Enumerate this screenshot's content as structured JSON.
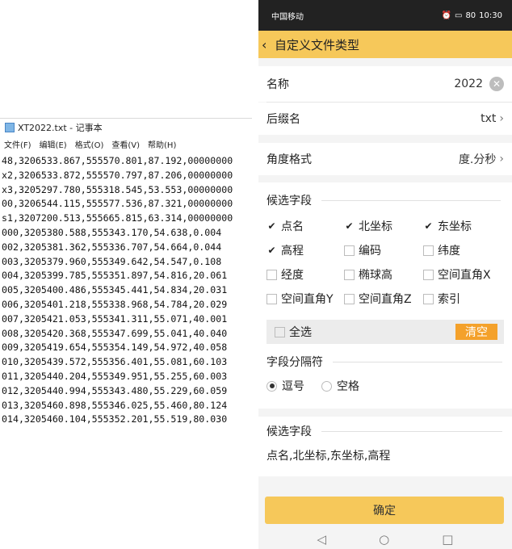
{
  "notepad": {
    "title": "XT2022.txt - 记事本",
    "menu": [
      "文件(F)",
      "编辑(E)",
      "格式(O)",
      "查看(V)",
      "帮助(H)"
    ],
    "lines": [
      "48,3206533.867,555570.801,87.192,00000000",
      "x2,3206533.872,555570.797,87.206,00000000",
      "x3,3205297.780,555318.545,53.553,00000000",
      "00,3206544.115,555577.536,87.321,00000000",
      "s1,3207200.513,555665.815,63.314,00000000",
      "000,3205380.588,555343.170,54.638,0.004",
      "002,3205381.362,555336.707,54.664,0.044",
      "003,3205379.960,555349.642,54.547,0.108",
      "004,3205399.785,555351.897,54.816,20.061",
      "005,3205400.486,555345.441,54.834,20.031",
      "006,3205401.218,555338.968,54.784,20.029",
      "007,3205421.053,555341.311,55.071,40.001",
      "008,3205420.368,555347.699,55.041,40.040",
      "009,3205419.654,555354.149,54.972,40.058",
      "010,3205439.572,555356.401,55.081,60.103",
      "011,3205440.204,555349.951,55.255,60.003",
      "012,3205440.994,555343.480,55.229,60.059",
      "013,3205460.898,555346.025,55.460,80.124",
      "014,3205460.104,555352.201,55.519,80.030"
    ]
  },
  "status_bar": {
    "carrier": "中国移动",
    "battery": "80",
    "time": "10:30"
  },
  "header": {
    "title": "自定义文件类型"
  },
  "form": {
    "name_label": "名称",
    "name_value": "2022",
    "suffix_label": "后缀名",
    "suffix_value": "txt",
    "angle_label": "角度格式",
    "angle_value": "度.分秒"
  },
  "fields_section": {
    "title": "候选字段",
    "items": [
      {
        "label": "点名",
        "checked": true
      },
      {
        "label": "北坐标",
        "checked": true
      },
      {
        "label": "东坐标",
        "checked": true
      },
      {
        "label": "高程",
        "checked": true
      },
      {
        "label": "编码",
        "checked": false
      },
      {
        "label": "纬度",
        "checked": false
      },
      {
        "label": "经度",
        "checked": false
      },
      {
        "label": "椭球高",
        "checked": false
      },
      {
        "label": "空间直角X",
        "checked": false
      },
      {
        "label": "空间直角Y",
        "checked": false
      },
      {
        "label": "空间直角Z",
        "checked": false
      },
      {
        "label": "索引",
        "checked": false
      }
    ],
    "select_all_label": "全选",
    "clear_label": "清空"
  },
  "separator_section": {
    "title": "字段分隔符",
    "comma_label": "逗号",
    "space_label": "空格",
    "selected": "comma"
  },
  "preview_section": {
    "title": "候选字段",
    "value": "点名,北坐标,东坐标,高程"
  },
  "confirm_label": "确定",
  "nav": {
    "back": "◁",
    "home": "○",
    "recent": "□"
  }
}
